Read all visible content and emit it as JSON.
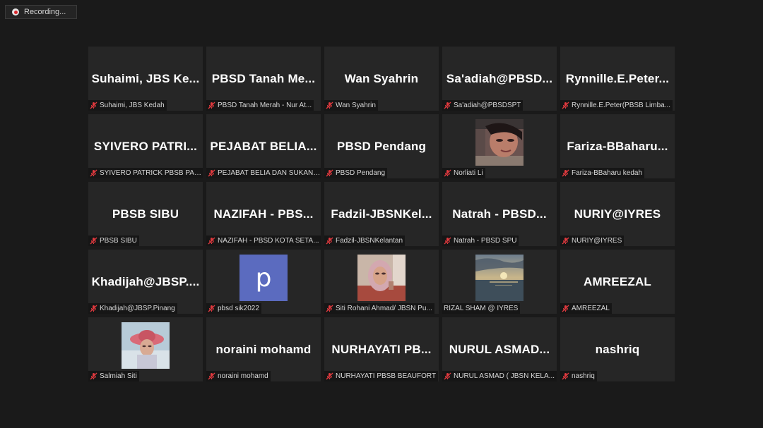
{
  "recording": {
    "label": "Recording..."
  },
  "participants": [
    {
      "display": "Suhaimi, JBS Ke...",
      "label": "Suhaimi, JBS Kedah",
      "muted": true
    },
    {
      "display": "PBSD Tanah Me...",
      "label": "PBSD Tanah Merah - Nur At...",
      "muted": true
    },
    {
      "display": "Wan Syahrin",
      "label": "Wan Syahrin",
      "muted": true
    },
    {
      "display": "Sa'adiah@PBSD...",
      "label": "Sa'adiah@PBSDSPT",
      "muted": true
    },
    {
      "display": "Rynnille.E.Peter...",
      "label": "Rynnille.E.Peter(PBSB Limba...",
      "muted": true
    },
    {
      "display": "SYIVERO PATRI...",
      "label": "SYIVERO PATRICK PBSB PAN...",
      "muted": true
    },
    {
      "display": "PEJABAT BELIA...",
      "label": "PEJABAT BELIA DAN SUKAN ...",
      "muted": true
    },
    {
      "display": "PBSD Pendang",
      "label": "PBSD Pendang",
      "muted": true
    },
    {
      "video": "video-woman",
      "label": "Norliati Li",
      "muted": true
    },
    {
      "display": "Fariza-BBaharu...",
      "label": "Fariza-BBaharu kedah",
      "muted": true
    },
    {
      "display": "PBSB SIBU",
      "label": "PBSB SIBU",
      "muted": true
    },
    {
      "display": "NAZIFAH - PBS...",
      "label": "NAZIFAH - PBSD KOTA SETA...",
      "muted": true
    },
    {
      "display": "Fadzil-JBSNKel...",
      "label": "Fadzil-JBSNKelantan",
      "muted": true
    },
    {
      "display": "Natrah - PBSD...",
      "label": "Natrah - PBSD SPU",
      "muted": true
    },
    {
      "display": "NURIY@IYRES",
      "label": "NURIY@IYRES",
      "muted": true
    },
    {
      "display": "Khadijah@JBSP....",
      "label": "Khadijah@JBSP.Pinang",
      "muted": true
    },
    {
      "avatar": "p",
      "label": "pbsd sik2022",
      "muted": true
    },
    {
      "video": "video-hijab",
      "label": "Siti Rohani Ahmad/ JBSN Pu...",
      "muted": true
    },
    {
      "video": "video-sunset",
      "label": "RIZAL SHAM @ IYRES",
      "muted": false
    },
    {
      "display": "AMREEZAL",
      "label": "AMREEZAL",
      "muted": true
    },
    {
      "video": "video-hat",
      "label": "Salmiah Siti",
      "muted": true
    },
    {
      "display": "noraini mohamd",
      "label": "noraini mohamd",
      "muted": true
    },
    {
      "display": "NURHAYATI PB...",
      "label": "NURHAYATI PBSB BEAUFORT",
      "muted": true
    },
    {
      "display": "NURUL ASMAD...",
      "label": "NURUL ASMAD ( JBSN KELA...",
      "muted": true
    },
    {
      "display": "nashriq",
      "label": "nashriq",
      "muted": true
    }
  ],
  "colors": {
    "muted_icon": "#e0393e",
    "tile": "#262626",
    "background": "#1a1a1a",
    "avatar": "#5b6bbf"
  }
}
